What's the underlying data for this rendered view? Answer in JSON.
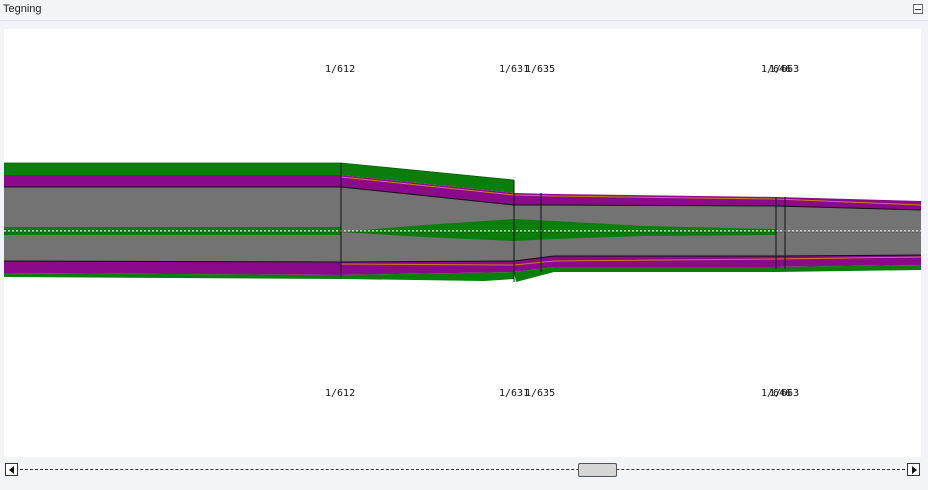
{
  "window": {
    "title": "Tegning"
  },
  "drawing": {
    "station_labels": [
      "1/612",
      "1/631",
      "1/635",
      "1/646",
      "1/663"
    ],
    "colors": {
      "green": "#0a7d0a",
      "purple": "#8a0a8a",
      "gray": "#737373",
      "line": "#111111",
      "orange": "#c8801e"
    }
  },
  "scrollbar": {
    "position": 0.66
  }
}
